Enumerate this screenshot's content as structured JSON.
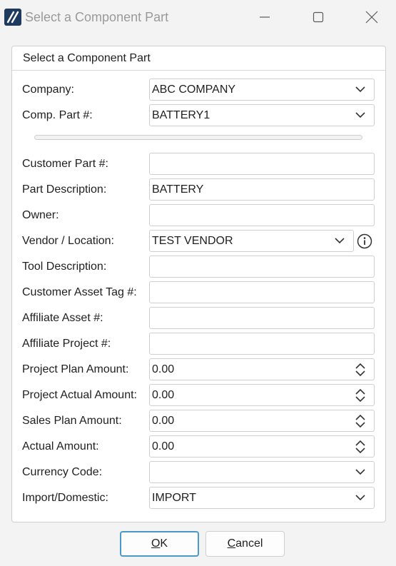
{
  "window": {
    "title": "Select a Component Part",
    "icons": {
      "app": "app-logo-icon",
      "minimize": "minimize-icon",
      "maximize": "maximize-icon",
      "close": "close-icon"
    }
  },
  "panel": {
    "header": "Select a Component Part",
    "fields": {
      "company": {
        "label": "Company:",
        "value": "ABC COMPANY"
      },
      "comp_part": {
        "label": "Comp. Part #:",
        "value": "BATTERY1"
      },
      "customer_part": {
        "label": "Customer Part #:",
        "value": ""
      },
      "part_description": {
        "label": "Part Description:",
        "value": "BATTERY"
      },
      "owner": {
        "label": "Owner:",
        "value": ""
      },
      "vendor_location": {
        "label": "Vendor / Location:",
        "value": "TEST VENDOR"
      },
      "tool_description": {
        "label": "Tool Description:",
        "value": ""
      },
      "customer_asset_tag": {
        "label": "Customer Asset Tag #:",
        "value": ""
      },
      "affiliate_asset": {
        "label": "Affiliate Asset #:",
        "value": ""
      },
      "affiliate_project": {
        "label": "Affiliate Project #:",
        "value": ""
      },
      "project_plan_amount": {
        "label": "Project Plan Amount:",
        "value": "0.00"
      },
      "project_actual_amount": {
        "label": "Project Actual Amount:",
        "value": "0.00"
      },
      "sales_plan_amount": {
        "label": "Sales Plan Amount:",
        "value": "0.00"
      },
      "actual_amount": {
        "label": "Actual Amount:",
        "value": "0.00"
      },
      "currency_code": {
        "label": "Currency Code:",
        "value": ""
      },
      "import_domestic": {
        "label": "Import/Domestic:",
        "value": "IMPORT"
      }
    }
  },
  "buttons": {
    "ok": {
      "mnemonic": "O",
      "rest": "K"
    },
    "cancel": {
      "mnemonic": "C",
      "rest": "ancel"
    }
  },
  "colors": {
    "ok_focus_border": "#4a9ac9",
    "app_icon_bg": "#1e3a5f",
    "title_text": "#9a9a9a"
  }
}
